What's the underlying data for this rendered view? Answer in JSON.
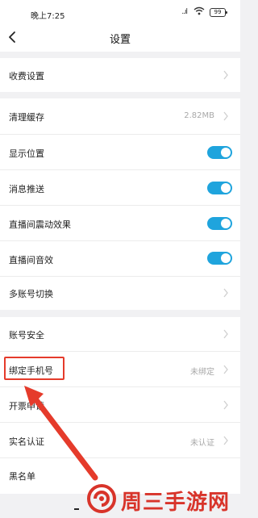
{
  "status_bar": {
    "time": "晚上7:25",
    "signal": "..ıl",
    "battery": "99"
  },
  "nav": {
    "title": "设置"
  },
  "groups": [
    {
      "label": "收费设置"
    },
    {
      "label": "清理缓存",
      "value": "2.82MB"
    },
    {
      "label": "显示位置",
      "toggle": "on"
    },
    {
      "label": "消息推送",
      "toggle": "on"
    },
    {
      "label": "直播间震动效果",
      "toggle": "on"
    },
    {
      "label": "直播间音效",
      "toggle": "on"
    },
    {
      "label": "多账号切换"
    },
    {
      "label": "账号安全"
    },
    {
      "label": "绑定手机号",
      "value": "未绑定"
    },
    {
      "label": "开票申请"
    },
    {
      "label": "实名认证",
      "value": "未认证"
    },
    {
      "label": "黑名单"
    }
  ],
  "watermark": {
    "text": "周三手游网"
  },
  "colors": {
    "accent": "#1fa4dd",
    "highlight": "#e53b2b"
  }
}
